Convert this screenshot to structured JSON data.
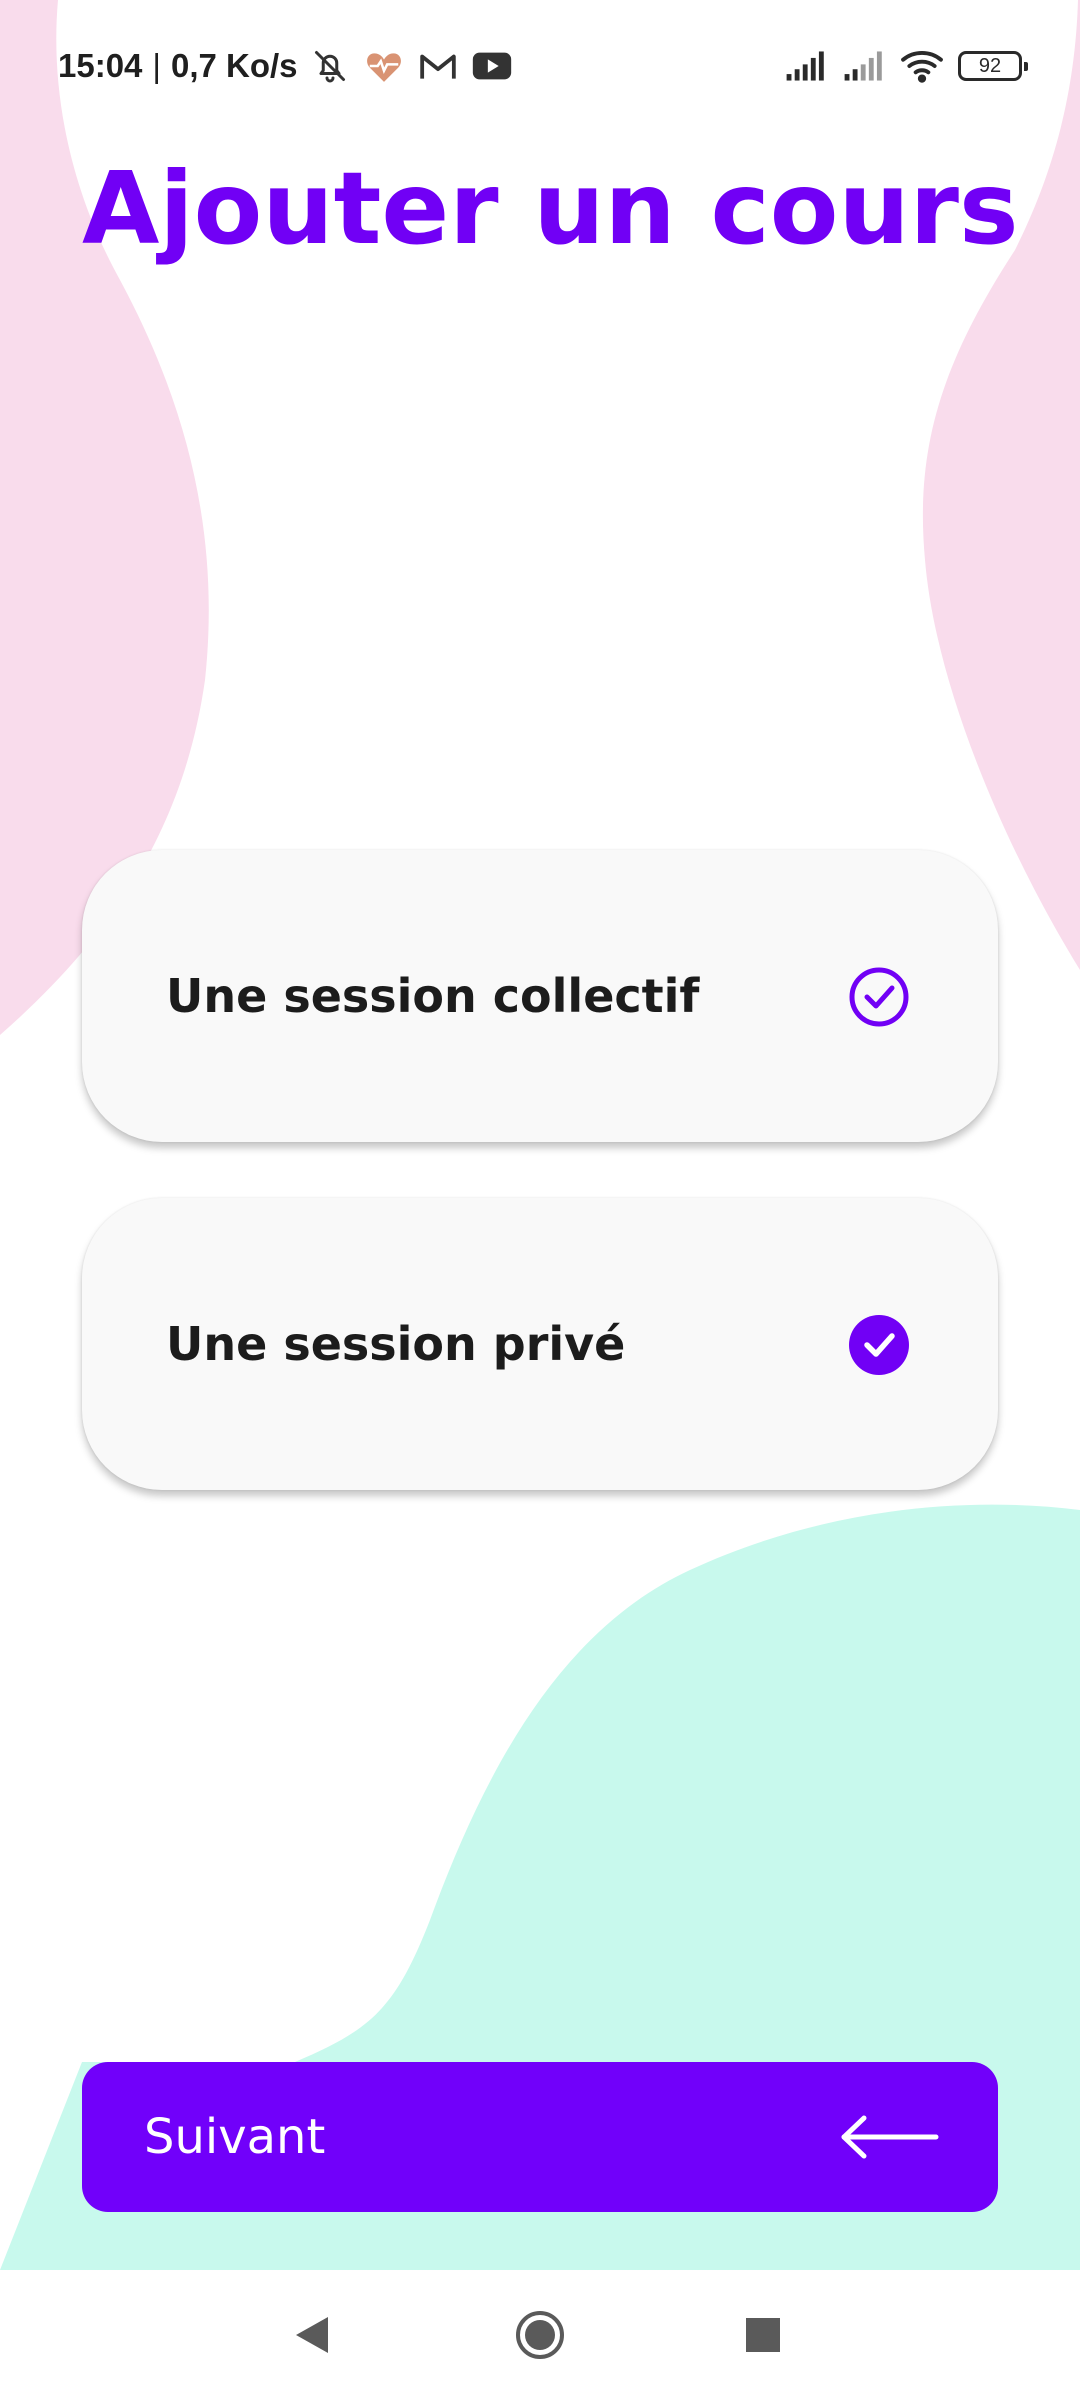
{
  "status_bar": {
    "time": "15:04",
    "separator": "|",
    "network_speed": "0,7 Ko/s",
    "notification_icons": [
      "bell-off-icon",
      "heart-pulse-icon",
      "gmail-icon",
      "youtube-icon"
    ],
    "system_icons": [
      "signal-icon",
      "signal-weak-icon",
      "wifi-icon"
    ],
    "battery": "92"
  },
  "page": {
    "title": "Ajouter un cours"
  },
  "options": [
    {
      "label": "Une session collectif",
      "selected": false
    },
    {
      "label": "Une session privé",
      "selected": true
    }
  ],
  "next_button": {
    "label": "Suivant",
    "icon": "arrow-left-icon"
  },
  "nav_bar": {
    "icons": [
      "back-icon",
      "home-icon",
      "recents-icon"
    ]
  },
  "colors": {
    "accent": "#7100f5",
    "pink_blob": "#f9dcec",
    "mint_blob": "#c8f9ed",
    "card_bg": "#f9f9f9",
    "text_dark": "#1c1c1c"
  }
}
